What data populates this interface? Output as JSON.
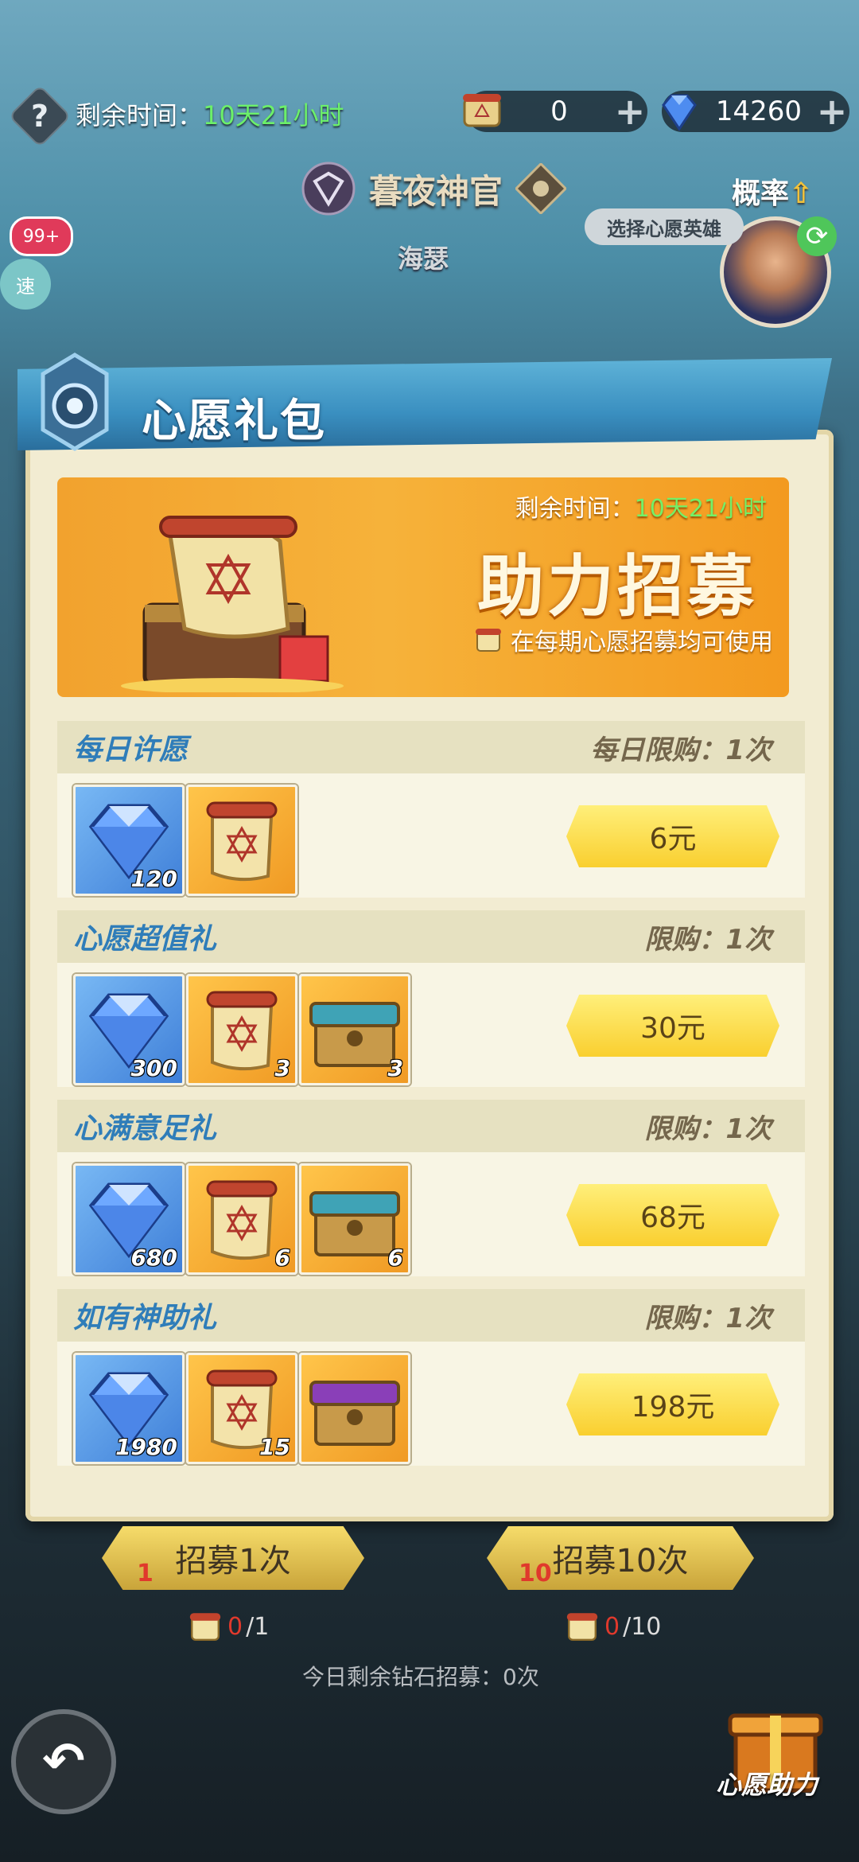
{
  "top": {
    "remaining_label": "剩余时间：",
    "remaining_value": "10天21小时",
    "scroll_count": "0",
    "diamond_count": "14260"
  },
  "hero_banner": {
    "title": "暮夜神官",
    "hero_name": "海瑟",
    "probability_label": "概率",
    "select_wish_hero": "选择心愿英雄"
  },
  "side": {
    "badge": "99+",
    "speed_label": "速"
  },
  "popup": {
    "title": "心愿礼包",
    "promo": {
      "time_label": "剩余时间：",
      "time_value": "10天21小时",
      "headline": "助力招募",
      "note": "在每期心愿招募均可使用"
    },
    "packs": [
      {
        "name": "每日许愿",
        "limit": "每日限购：1次",
        "price": "6元",
        "items": [
          {
            "type": "diamond",
            "count": "120"
          },
          {
            "type": "scroll",
            "count": ""
          }
        ]
      },
      {
        "name": "心愿超值礼",
        "limit": "限购：1次",
        "price": "30元",
        "items": [
          {
            "type": "diamond",
            "count": "300"
          },
          {
            "type": "scroll",
            "count": "3"
          },
          {
            "type": "chest-blue",
            "count": "3"
          }
        ]
      },
      {
        "name": "心满意足礼",
        "limit": "限购：1次",
        "price": "68元",
        "items": [
          {
            "type": "diamond",
            "count": "680"
          },
          {
            "type": "scroll",
            "count": "6"
          },
          {
            "type": "chest-blue",
            "count": "6"
          }
        ]
      },
      {
        "name": "如有神助礼",
        "limit": "限购：1次",
        "price": "198元",
        "items": [
          {
            "type": "diamond",
            "count": "1980"
          },
          {
            "type": "scroll",
            "count": "15"
          },
          {
            "type": "chest-purple",
            "count": ""
          }
        ]
      }
    ]
  },
  "bottom": {
    "recruit_1": {
      "label": "招募1次",
      "cost_badge": "1",
      "have": "0",
      "need": "/1"
    },
    "recruit_10": {
      "label": "招募10次",
      "cost_badge": "10",
      "have": "0",
      "need": "/10"
    },
    "today_remaining": "今日剩余钻石招募：0次",
    "wish_help": "心愿助力"
  },
  "colors": {
    "accent_blue": "#2f7db9",
    "green_time": "#6cf06a",
    "price_gold": "#f9cf2f"
  }
}
